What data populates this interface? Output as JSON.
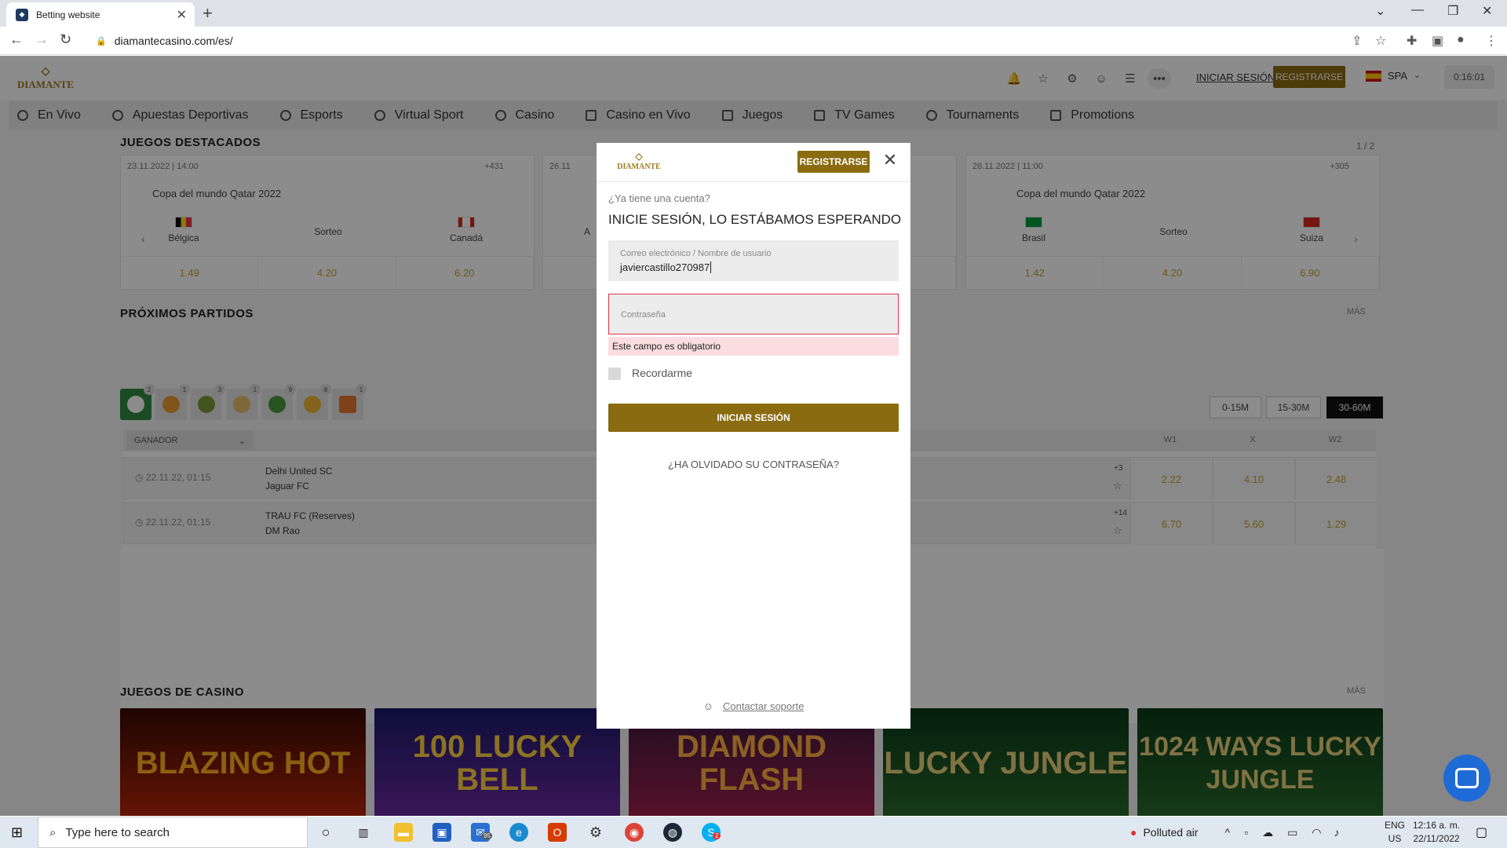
{
  "browser": {
    "tab_title": "Betting website",
    "url": "diamantecasino.com/es/"
  },
  "header": {
    "logo_text": "DIAMANTE",
    "login_link": "INICIAR SESIÓN",
    "register": "REGISTRARSE",
    "language": "SPA",
    "clock": "0:16:01"
  },
  "nav": {
    "items": [
      {
        "label": "En Vivo"
      },
      {
        "label": "Apuestas Deportivas"
      },
      {
        "label": "Esports"
      },
      {
        "label": "Virtual Sport"
      },
      {
        "label": "Casino"
      },
      {
        "label": "Casino en Vivo"
      },
      {
        "label": "Juegos"
      },
      {
        "label": "TV Games"
      },
      {
        "label": "Tournaments"
      },
      {
        "label": "Promotions"
      }
    ]
  },
  "featured": {
    "title": "JUEGOS DESTACADOS",
    "pager": "1 / 2",
    "cards": [
      {
        "date": "23.11.2022 | 14:00",
        "count": "+431",
        "league": "Copa del mundo Qatar 2022",
        "home": "Bélgica",
        "draw": "Sorteo",
        "away": "Canadá",
        "odds": [
          "1.49",
          "4.20",
          "6.20"
        ]
      },
      {
        "date": "26.11",
        "count": "",
        "league": "",
        "home": "A",
        "draw": "",
        "away": "",
        "odds": [
          "",
          "",
          ""
        ]
      },
      {
        "date": "28.11.2022 | 11:00",
        "count": "+305",
        "league": "Copa del mundo Qatar 2022",
        "home": "Brasil",
        "draw": "Sorteo",
        "away": "Suiza",
        "odds": [
          "1.42",
          "4.20",
          "6.90"
        ]
      }
    ]
  },
  "upcoming": {
    "title": "PRÓXIMOS PARTIDOS",
    "more": "MÁS",
    "sport_counts": [
      "2",
      "1",
      "3",
      "1",
      "9",
      "8",
      "1"
    ],
    "time_filters": [
      "0-15M",
      "15-30M",
      "30-60M"
    ],
    "market": "GANADOR",
    "columns": [
      "W1",
      "X",
      "W2"
    ],
    "rows": [
      {
        "time": "22.11.22, 01:15",
        "home": "Delhi United SC",
        "away": "Jaguar FC",
        "more": "+3",
        "odds": [
          "2.22",
          "4.10",
          "2.48"
        ]
      },
      {
        "time": "22.11.22, 01:15",
        "home": "TRAU FC (Reserves)",
        "away": "DM Rao",
        "more": "+14",
        "odds": [
          "6.70",
          "5.60",
          "1.29"
        ]
      }
    ]
  },
  "casino": {
    "title": "JUEGOS DE CASINO",
    "more": "MÁS",
    "games": [
      "BLAZING HOT",
      "100 LUCKY BELL",
      "DIAMOND FLASH",
      "LUCKY JUNGLE",
      "1024 WAYS LUCKY JUNGLE"
    ]
  },
  "modal": {
    "logo_text": "DIAMANTE",
    "register": "REGISTRARSE",
    "question": "¿Ya tiene una cuenta?",
    "title": "INICIE SESIÓN, LO ESTÁBAMOS ESPERANDO",
    "user_label": "Correo electrónico / Nombre de usuario",
    "user_value": "javiercastillo270987",
    "password_placeholder": "Contraseña",
    "error": "Este campo es obligatorio",
    "remember": "Recordarme",
    "submit": "INICIAR SESIÓN",
    "forgot": "¿HA OLVIDADO SU CONTRASEÑA?",
    "support": "Contactar soporte"
  },
  "taskbar": {
    "search": "Type here to search",
    "mail_badge": "95",
    "skype_badge": "2",
    "weather": "Polluted air",
    "lang1": "ENG",
    "lang2": "US",
    "time": "12:16 a. m.",
    "date": "22/11/2022"
  }
}
